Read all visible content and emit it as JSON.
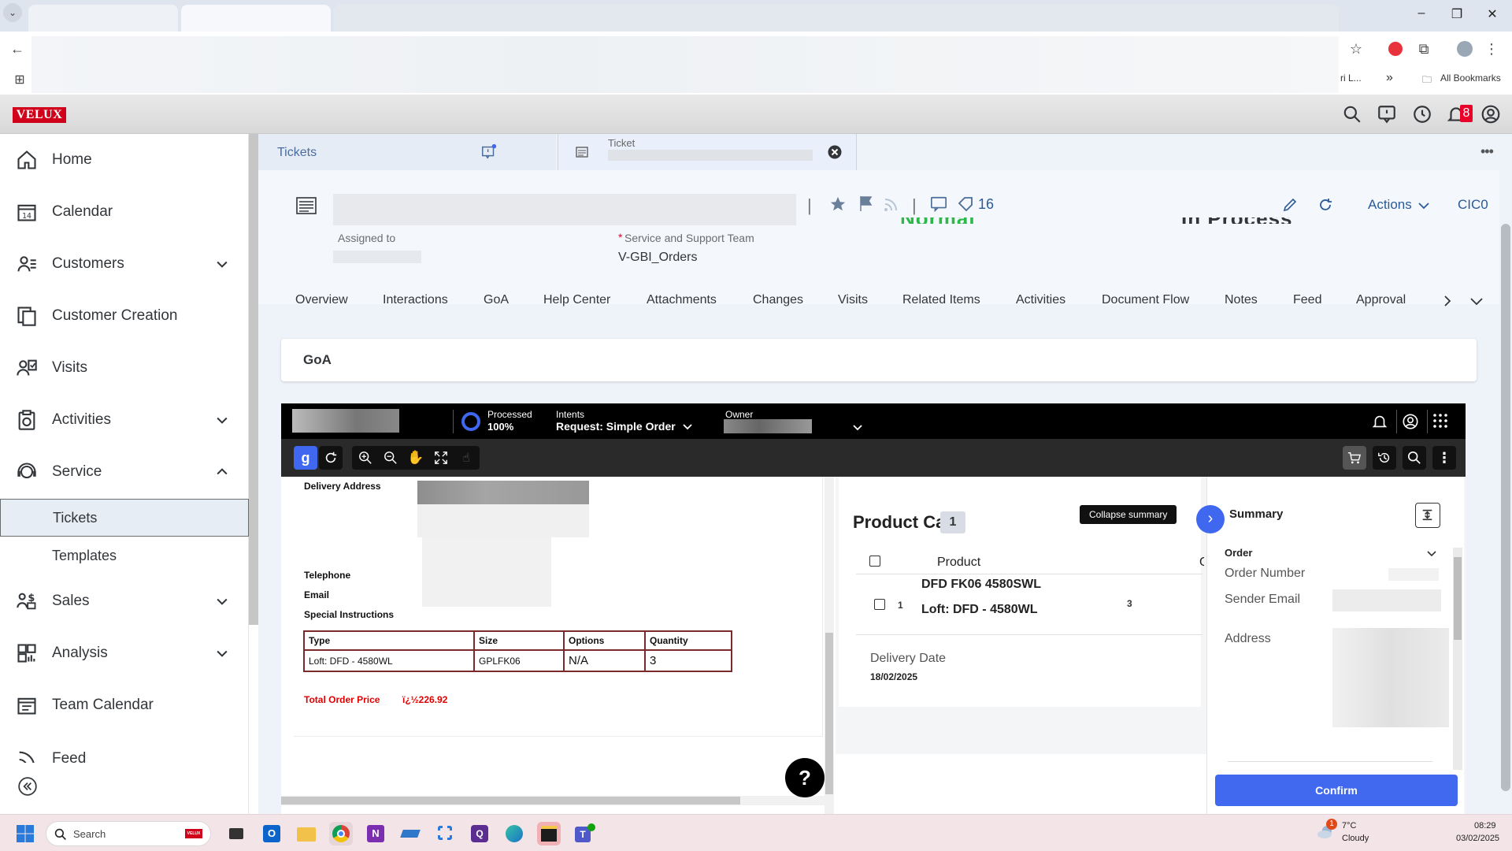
{
  "browser": {
    "bookmark_partial": "ri L...",
    "bookmarks_overflow": "»",
    "all_bookmarks": "All Bookmarks"
  },
  "app": {
    "logo": "VELUX",
    "notification_count": "8"
  },
  "sidebar": {
    "items": [
      {
        "label": "Home",
        "icon": "home-icon",
        "expandable": false
      },
      {
        "label": "Calendar",
        "icon": "calendar-icon",
        "expandable": false
      },
      {
        "label": "Customers",
        "icon": "customers-icon",
        "expandable": true
      },
      {
        "label": "Customer Creation",
        "icon": "customer-creation-icon",
        "expandable": false
      },
      {
        "label": "Visits",
        "icon": "visits-icon",
        "expandable": false
      },
      {
        "label": "Activities",
        "icon": "activities-icon",
        "expandable": true
      },
      {
        "label": "Service",
        "icon": "service-icon",
        "expandable": true,
        "expanded": true
      },
      {
        "label": "Sales",
        "icon": "sales-icon",
        "expandable": true
      },
      {
        "label": "Analysis",
        "icon": "analysis-icon",
        "expandable": true
      },
      {
        "label": "Team Calendar",
        "icon": "team-calendar-icon",
        "expandable": false
      },
      {
        "label": "Feed",
        "icon": "feed-icon",
        "expandable": false
      }
    ],
    "service_children": [
      "Tickets",
      "Templates"
    ],
    "active_child": "Tickets"
  },
  "workspace_tabs": {
    "tickets": "Tickets",
    "ticket": "Ticket"
  },
  "object_header": {
    "tag_count": "16",
    "actions_label": "Actions",
    "user_code": "CIC0",
    "assigned_to_label": "Assigned to",
    "required_mark": "*",
    "team_label": "Service and Support Team",
    "team_value": "V-GBI_Orders"
  },
  "subtabs": [
    "Overview",
    "Interactions",
    "GoA",
    "Help Center",
    "Attachments",
    "Changes",
    "Visits",
    "Related Items",
    "Activities",
    "Document Flow",
    "Notes",
    "Feed",
    "Approval"
  ],
  "goa_panel_title": "GoA",
  "goa_app": {
    "processed_label": "Processed",
    "processed_value": "100%",
    "processed_fraction": 1.0,
    "intents_label": "Intents",
    "intents_value": "Request: Simple Order",
    "owner_label": "Owner"
  },
  "document": {
    "delivery_address_label": "Delivery Address",
    "telephone_label": "Telephone",
    "email_label": "Email",
    "special_instructions_label": "Special Instructions",
    "table": {
      "headers": [
        "Type",
        "Size",
        "Options",
        "Quantity"
      ],
      "rows": [
        [
          "Loft: DFD - 4580WL",
          "GPLFK06",
          "N/A",
          "3"
        ]
      ]
    },
    "total_label": "Total Order Price",
    "total_value": "ï¿½226.92"
  },
  "cart": {
    "title": "Product Cart",
    "count": "1",
    "column_product": "Product",
    "item": {
      "index": "1",
      "name": "DFD FK06 4580SWL",
      "subtitle": "Loft: DFD - 4580WL",
      "quantity": "3"
    },
    "delivery_date_label": "Delivery Date",
    "delivery_date_value": "18/02/2025"
  },
  "summary": {
    "tooltip": "Collapse summary",
    "title": "Summary",
    "section": "Order",
    "fields": [
      "Order Number",
      "Sender Email",
      "Address"
    ],
    "confirm": "Confirm"
  },
  "taskbar": {
    "search_placeholder": "Search",
    "search_badge": "VELUX",
    "weather_badge": "1",
    "weather_temp": "7°C",
    "weather_desc": "Cloudy",
    "time": "08:29",
    "date": "03/02/2025"
  },
  "colors": {
    "brand": "#d0021b",
    "accent": "#4169f0",
    "total_price": "#e00000"
  }
}
